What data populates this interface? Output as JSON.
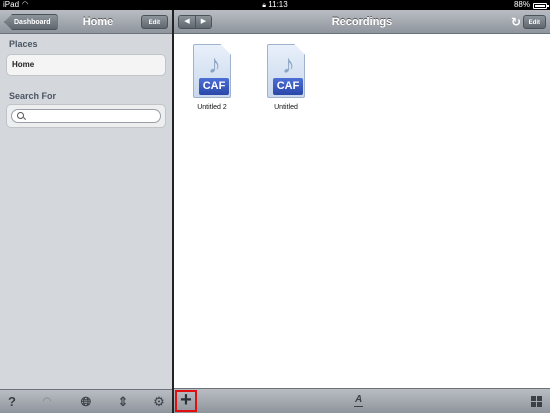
{
  "status_bar": {
    "device": "iPad",
    "time": "11:13",
    "battery": "88%"
  },
  "left_pane": {
    "back_label": "Dashboard",
    "title": "Home",
    "edit_label": "Edit",
    "places_header": "Places",
    "places_items": [
      {
        "label": "Home"
      }
    ],
    "search_header": "Search For",
    "search": {
      "value": "",
      "placeholder": ""
    }
  },
  "right_pane": {
    "title": "Recordings",
    "edit_label": "Edit",
    "files": [
      {
        "name": "Untitled 2",
        "type_badge": "CAF"
      },
      {
        "name": "Untitled",
        "type_badge": "CAF"
      }
    ]
  },
  "icons": {
    "left_toolbar": [
      "help-icon",
      "wifi-icon",
      "globe-icon",
      "sort-icon",
      "gear-icon"
    ],
    "right_toolbar": [
      "add-icon",
      "font-icon",
      "grid-view-icon"
    ]
  },
  "colors": {
    "toolbar_top": "#b9bdc3",
    "toolbar_bottom": "#8f959d",
    "sidebar_bg": "#d4d7db",
    "caf_badge": "#2a47a8",
    "highlight": "#e01010"
  }
}
